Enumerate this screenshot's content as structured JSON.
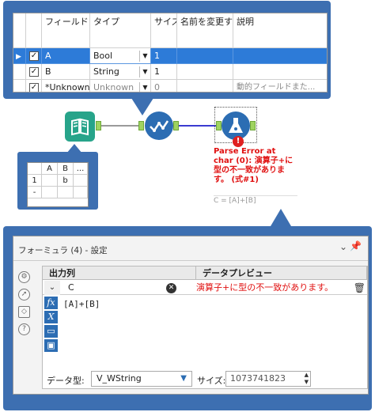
{
  "select_tool_table": {
    "headers": {
      "field": "フィールド",
      "type": "タイプ",
      "size": "サイズ",
      "rename": "名前を変更する",
      "description": "説明"
    },
    "rows": [
      {
        "selected": true,
        "checked": true,
        "field": "A",
        "type": "Bool",
        "size": "1",
        "rename": "",
        "description": ""
      },
      {
        "selected": false,
        "checked": true,
        "field": "B",
        "type": "String",
        "size": "1",
        "rename": "",
        "description": ""
      },
      {
        "selected": false,
        "checked": true,
        "field": "*Unknown",
        "type": "Unknown",
        "size": "0",
        "rename": "",
        "description": "動的フィールドまた..."
      }
    ]
  },
  "browse_preview": {
    "headers": [
      "A",
      "B",
      "..."
    ],
    "rows": [
      {
        "index": "1",
        "a": "",
        "b": "b"
      },
      {
        "index": "-",
        "a": "",
        "b": ""
      }
    ]
  },
  "workflow": {
    "error_message": "Parse Error at char (0): 演算子+に型の不一致があります。 (式#1)",
    "error_formula": "C = [A]+[B]",
    "error_badge": "!"
  },
  "formula_panel": {
    "title": "フォーミュラ (4) - 設定",
    "column_output": "出力列",
    "column_preview": "データプレビュー",
    "output_field": "C",
    "preview_value": "演算子+に型の不一致があります。",
    "expression": "[A]+[B]",
    "datatype_label": "データ型:",
    "datatype_value": "V_WString",
    "size_label": "サイズ:",
    "size_value": "1073741823"
  }
}
